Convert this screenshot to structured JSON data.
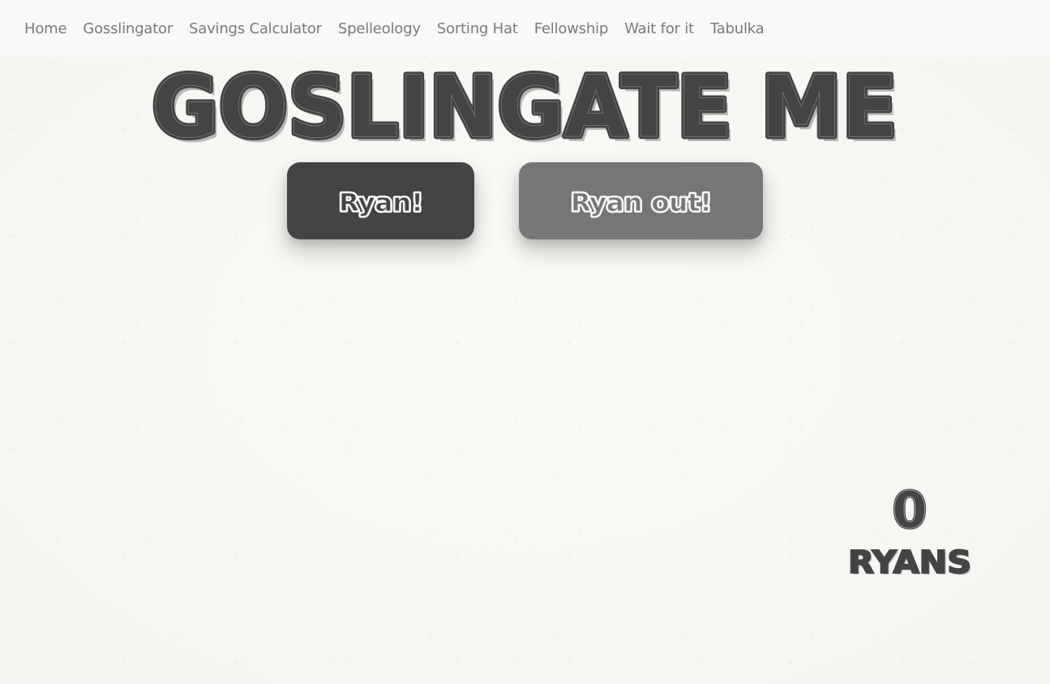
{
  "nav": {
    "items": [
      {
        "label": "Home"
      },
      {
        "label": "Gosslingator"
      },
      {
        "label": "Savings Calculator"
      },
      {
        "label": "Spelleology"
      },
      {
        "label": "Sorting Hat"
      },
      {
        "label": "Fellowship"
      },
      {
        "label": "Wait for it"
      },
      {
        "label": "Tabulka"
      }
    ]
  },
  "header": {
    "title": "GOSLINGATE ME"
  },
  "buttons": {
    "ryan_label": "Ryan!",
    "ryan_out_label": "Ryan out!"
  },
  "counter": {
    "count": "0",
    "unit_label": "RYANS"
  },
  "colors": {
    "navbar_bg": "#f8f9fa",
    "nav_text": "#7a7a7a",
    "title_dark": "#444444",
    "button_dark": "#444444",
    "button_grey": "#767676",
    "page_bg": "#f8f7f4"
  }
}
